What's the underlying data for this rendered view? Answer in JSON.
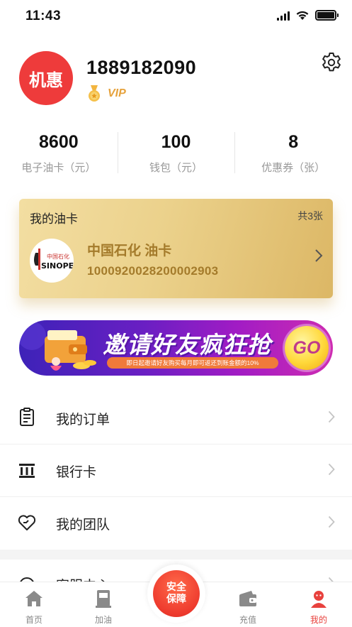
{
  "status_bar": {
    "time": "11:43"
  },
  "profile": {
    "avatar_text": "机惠",
    "phone": "1889182090",
    "vip_label": "VIP"
  },
  "stats": [
    {
      "value": "8600",
      "label": "电子油卡（元）"
    },
    {
      "value": "100",
      "label": "钱包（元）"
    },
    {
      "value": "8",
      "label": "优惠券（张）"
    }
  ],
  "oil_card": {
    "title": "我的油卡",
    "count": "共3张",
    "name": "中国石化 油卡",
    "number": "1000920028200002903",
    "logo_text": "SINOPEC"
  },
  "banner": {
    "title": "邀请好友疯狂抢",
    "subtitle": "即日起邀请好友购买每月即可返还到账金额的10%",
    "go_label": "GO"
  },
  "menu": [
    {
      "label": "我的订单",
      "icon": "order-list-icon"
    },
    {
      "label": "银行卡",
      "icon": "bank-card-icon"
    },
    {
      "label": "我的团队",
      "icon": "team-heart-icon"
    },
    {
      "label": "客服中心",
      "icon": "customer-service-icon"
    }
  ],
  "tab_bar": {
    "tabs": [
      {
        "label": "首页",
        "icon": "home-icon"
      },
      {
        "label": "加油",
        "icon": "fuel-pump-icon"
      },
      {
        "label": "充值",
        "icon": "wallet-icon"
      },
      {
        "label": "我的",
        "icon": "profile-icon",
        "active": true
      }
    ],
    "center_label_1": "安全",
    "center_label_2": "保障"
  },
  "colors": {
    "brand_red": "#ee3b3b",
    "gold_text": "#a47b2b",
    "vip_gold": "#e6a23c",
    "active_tab": "#e8413d"
  }
}
